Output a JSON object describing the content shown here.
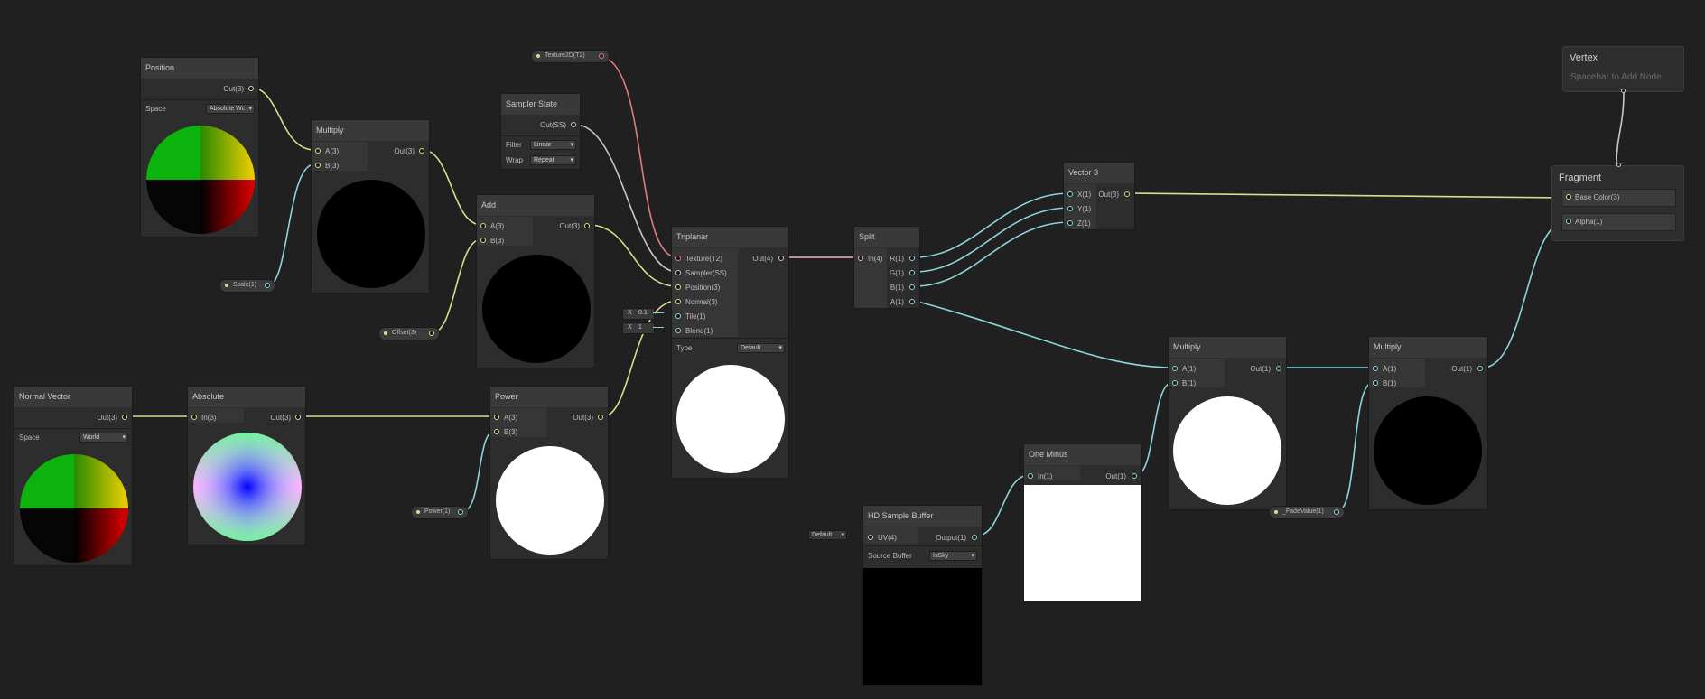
{
  "colors": {
    "background": "#202020",
    "float_wire": "#8ad6dc",
    "vector3_wire": "#d6df8a",
    "texture_wire": "#e27b80",
    "sampler_wire": "#c8c8c8",
    "vector4_wire": "#f0b8c8"
  },
  "position_node": {
    "title": "Position",
    "out": "Out(3)",
    "space_label": "Space",
    "space_value": "Absolute Wc"
  },
  "multiply1": {
    "title": "Multiply",
    "in_a": "A(3)",
    "in_b": "B(3)",
    "out": "Out(3)"
  },
  "scale_prop": {
    "label": "Scale(1)"
  },
  "texture_prop": {
    "label": "Texture2D(T2)"
  },
  "sampler_state": {
    "title": "Sampler State",
    "out": "Out(SS)",
    "filter_label": "Filter",
    "filter_value": "Linear",
    "wrap_label": "Wrap",
    "wrap_value": "Repeat"
  },
  "add_node": {
    "title": "Add",
    "in_a": "A(3)",
    "in_b": "B(3)",
    "out": "Out(3)"
  },
  "offset_prop": {
    "label": "Offset(3)"
  },
  "triplanar": {
    "title": "Triplanar",
    "in_texture": "Texture(T2)",
    "in_sampler": "Sampler(SS)",
    "in_position": "Position(3)",
    "in_normal": "Normal(3)",
    "in_tile": "Tile(1)",
    "in_blend": "Blend(1)",
    "out": "Out(4)",
    "type_label": "Type",
    "type_value": "Default",
    "tile_axis": "X",
    "tile_value": "0.1",
    "blend_axis": "X",
    "blend_value": "1"
  },
  "split_node": {
    "title": "Split",
    "in": "In(4)",
    "out_r": "R(1)",
    "out_g": "G(1)",
    "out_b": "B(1)",
    "out_a": "A(1)"
  },
  "vector3_node": {
    "title": "Vector 3",
    "in_x": "X(1)",
    "in_y": "Y(1)",
    "in_z": "Z(1)",
    "out": "Out(3)"
  },
  "vertex_context": {
    "title": "Vertex",
    "hint": "Spacebar to Add Node"
  },
  "fragment_context": {
    "title": "Fragment",
    "base_color": "Base Color(3)",
    "alpha": "Alpha(1)"
  },
  "normal_vector": {
    "title": "Normal Vector",
    "out": "Out(3)",
    "space_label": "Space",
    "space_value": "World"
  },
  "absolute_node": {
    "title": "Absolute",
    "in": "In(3)",
    "out": "Out(3)"
  },
  "power_node": {
    "title": "Power",
    "in_a": "A(3)",
    "in_b": "B(3)",
    "out": "Out(3)"
  },
  "power_prop": {
    "label": "Power(1)"
  },
  "hd_sample_buffer": {
    "title": "HD Sample Buffer",
    "in_uv": "UV(4)",
    "out": "Output(1)",
    "source_label": "Source Buffer",
    "source_value": "IsSky",
    "uv_default": "Default"
  },
  "one_minus": {
    "title": "One Minus",
    "in": "In(1)",
    "out": "Out(1)"
  },
  "multiply2": {
    "title": "Multiply",
    "in_a": "A(1)",
    "in_b": "B(1)",
    "out": "Out(1)"
  },
  "multiply3": {
    "title": "Multiply",
    "in_a": "A(1)",
    "in_b": "B(1)",
    "out": "Out(1)"
  },
  "fade_prop": {
    "label": "_FadeValue(1)"
  }
}
